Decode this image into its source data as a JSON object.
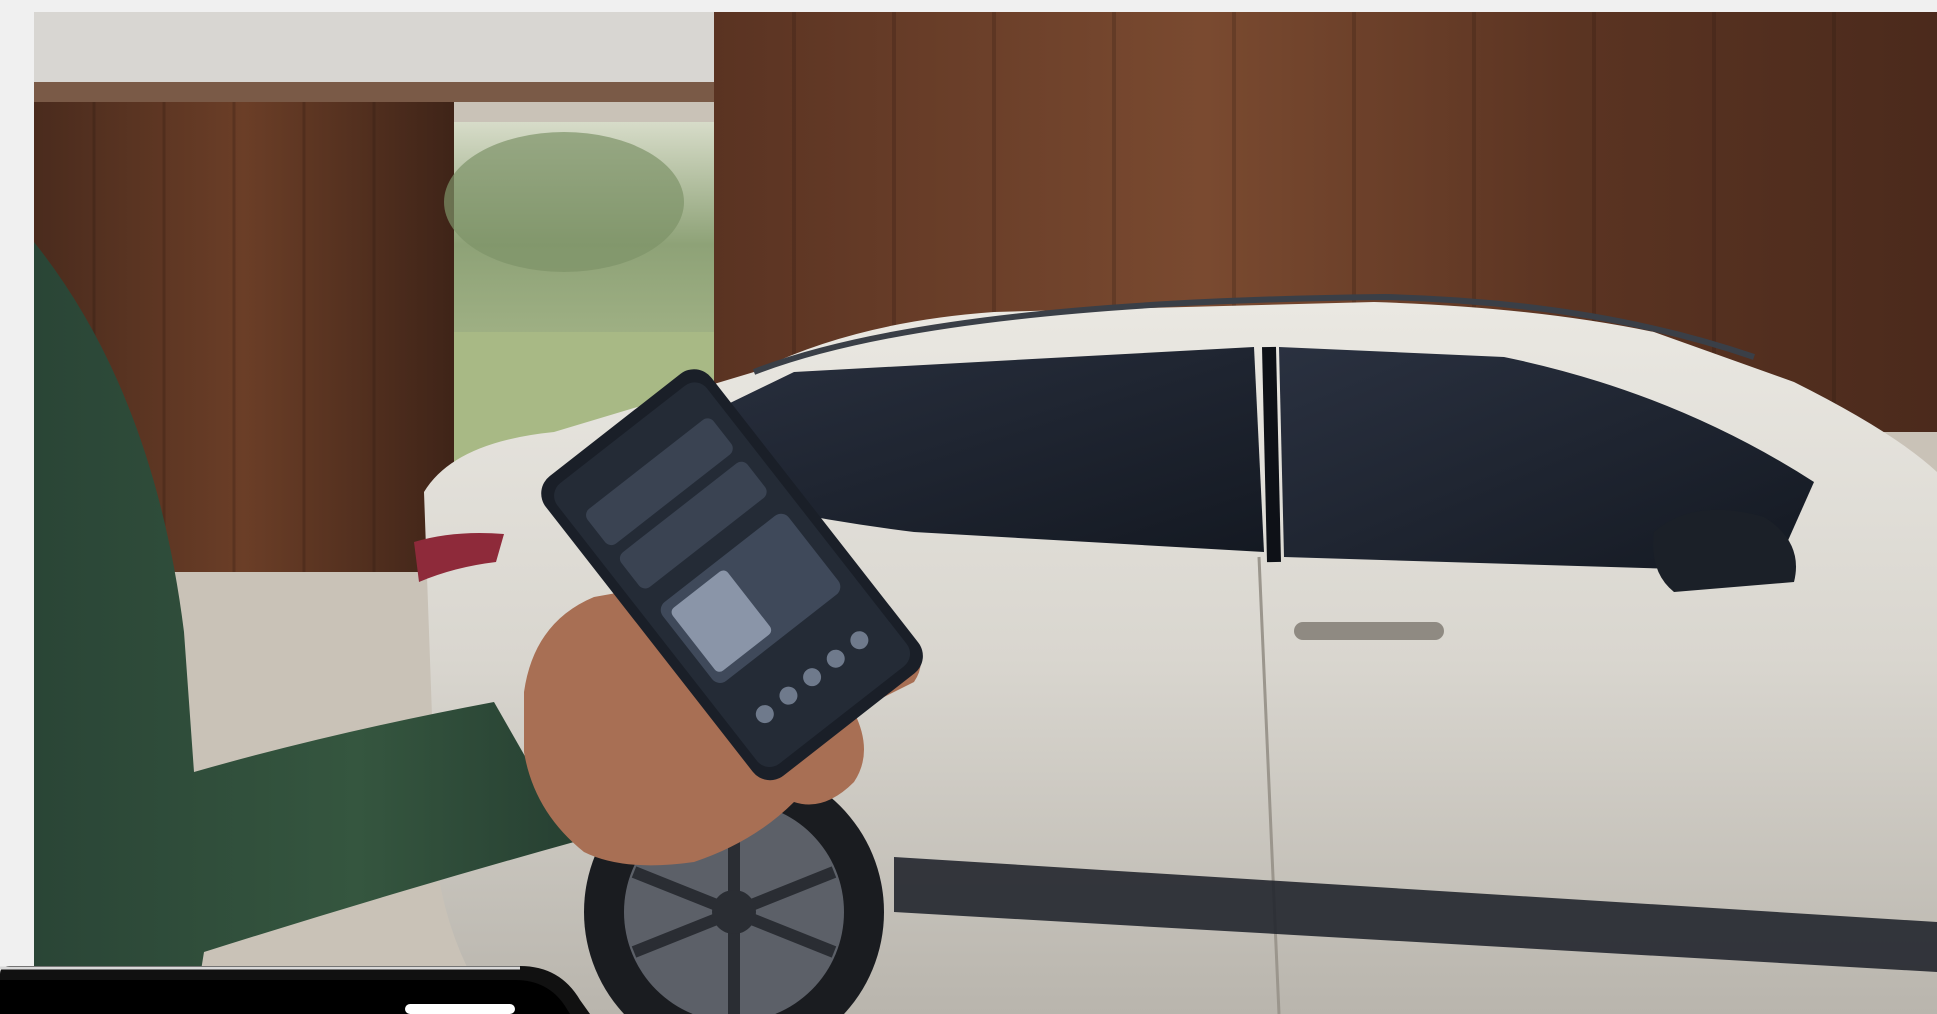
{
  "scene": {
    "subject": "photo-person-holding-phone-beside-car",
    "colors": {
      "wood_wall": "#5b3422",
      "car_body": "#d9d6cf",
      "car_glass": "#1d2330",
      "sleeve": "#2f4b3b",
      "skin": "#a86f54",
      "phone": "#1a1f28",
      "sky_opening": "#b7c9a1",
      "ground": "#c9c2b7"
    }
  },
  "phone_app": {
    "screen_theme": "dark",
    "icon_names": [
      "menu-icon",
      "car-icon",
      "lock-icon",
      "climate-icon",
      "charge-icon"
    ]
  },
  "mockup": {
    "device": "phone-frame-edge"
  }
}
